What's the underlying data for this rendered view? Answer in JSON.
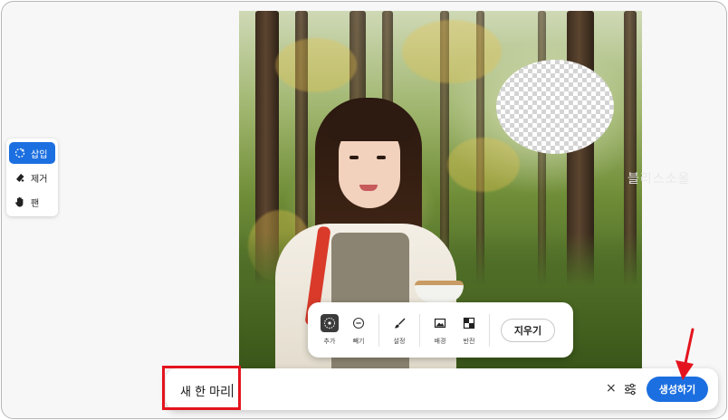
{
  "watermark": "블리스소울",
  "tool_panel": {
    "items": [
      {
        "label": "삽입",
        "icon": "sparkle-select-icon",
        "active": true
      },
      {
        "label": "제거",
        "icon": "eraser-icon",
        "active": false
      },
      {
        "label": "팬",
        "icon": "hand-icon",
        "active": false
      }
    ]
  },
  "brush_toolbar": {
    "items": [
      {
        "label": "추가",
        "icon": "brush-add-icon",
        "active": true
      },
      {
        "label": "빼기",
        "icon": "minus-circle-icon",
        "active": false
      },
      {
        "label": "설정",
        "icon": "brush-icon",
        "active": false
      },
      {
        "label": "배경",
        "icon": "image-icon",
        "active": false
      },
      {
        "label": "반전",
        "icon": "invert-icon",
        "active": false
      }
    ],
    "erase_label": "지우기"
  },
  "prompt": {
    "value": "새 한 마리",
    "clear_symbol": "×",
    "generate_label": "생성하기"
  },
  "colors": {
    "accent": "#1c6fe0",
    "annotation": "#e4141e"
  }
}
